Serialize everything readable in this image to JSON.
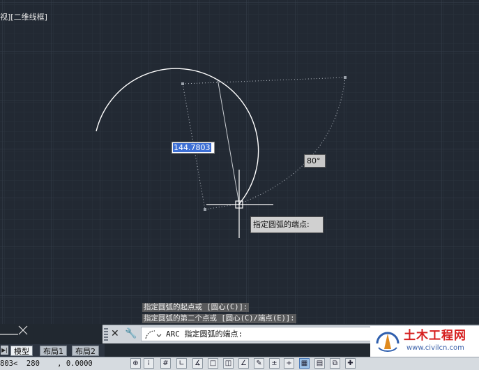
{
  "viewport": {
    "label": "视][二维线框]",
    "dimension_input": "144.7803",
    "angle_tooltip": "80°",
    "prompt_tooltip": "指定圆弧的端点:"
  },
  "command_history": [
    "指定圆弧的起点或 [圆心(C)]:",
    "指定圆弧的第二个点或 [圆心(C)/端点(E)]:"
  ],
  "command_line": {
    "text": "ARC 指定圆弧的端点:",
    "close_icon": "close-icon",
    "settings_icon": "wrench-icon"
  },
  "layout_tabs": [
    {
      "label": "模型",
      "active": true
    },
    {
      "label": "布局1",
      "active": false
    },
    {
      "label": "布局2",
      "active": false
    }
  ],
  "status_bar": {
    "coordinates": "803<  280    , 0.0000"
  },
  "watermark": {
    "brand": "土木工程网",
    "url": "www.civilcn.com"
  },
  "colors": {
    "canvas": "#222933",
    "arc": "#ffffff",
    "selection": "#3d6fd4",
    "brand_red": "#d62020",
    "brand_blue": "#3a5fa8"
  }
}
